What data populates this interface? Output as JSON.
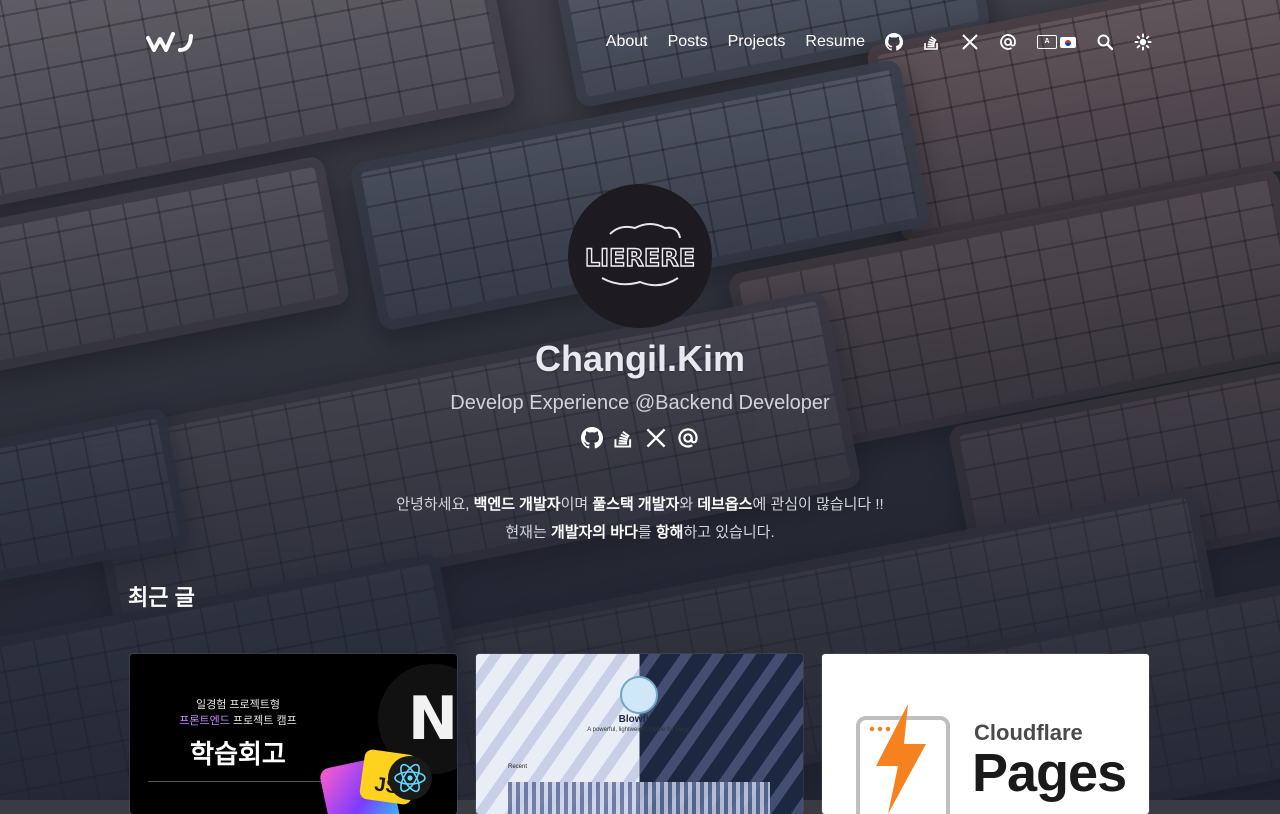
{
  "header": {
    "logo_alt": "wJ",
    "nav": [
      {
        "label": "About"
      },
      {
        "label": "Posts"
      },
      {
        "label": "Projects"
      },
      {
        "label": "Resume"
      }
    ],
    "icons": [
      "github-icon",
      "stackoverflow-icon",
      "x-icon",
      "at-icon",
      "language-switch-icon",
      "search-icon",
      "theme-toggle-icon"
    ]
  },
  "hero": {
    "avatar_text": "LIERERE",
    "name": "Changil.Kim",
    "tagline": "Develop Experience @Backend Developer",
    "socials": [
      "github-icon",
      "stackoverflow-icon",
      "x-icon",
      "at-icon"
    ],
    "intro_line1": {
      "p1": "안녕하세요, ",
      "b1": "백엔드 개발자",
      "p2": "이며 ",
      "b2": "풀스택 개발자",
      "p3": "와 ",
      "b3": "데브옵스",
      "p4": "에 관심이 많습니다 !!"
    },
    "intro_line2": {
      "p1": "현재는 ",
      "b1": "개발자의 바다",
      "p2": "를 ",
      "b2": "항해",
      "p3": "하고 있습니다."
    }
  },
  "recent": {
    "title": "최근 글",
    "cards": [
      {
        "line1": "일경험 프로젝트형",
        "line2_accent": "프론트엔드",
        "line2_rest": " 프로젝트 캠프",
        "line3": "학습회고",
        "badge_next": "N",
        "badge_js": "JS"
      },
      {
        "brand": "Blowfish",
        "subtitle": "A powerful, lightweight theme for Hugo.",
        "section": "Recent"
      },
      {
        "brand": "Cloudflare",
        "product": "Pages"
      }
    ]
  },
  "colors": {
    "accent_purple": "#c58cff",
    "cloudflare_orange": "#f6821f",
    "js_yellow": "#ffd21f"
  }
}
